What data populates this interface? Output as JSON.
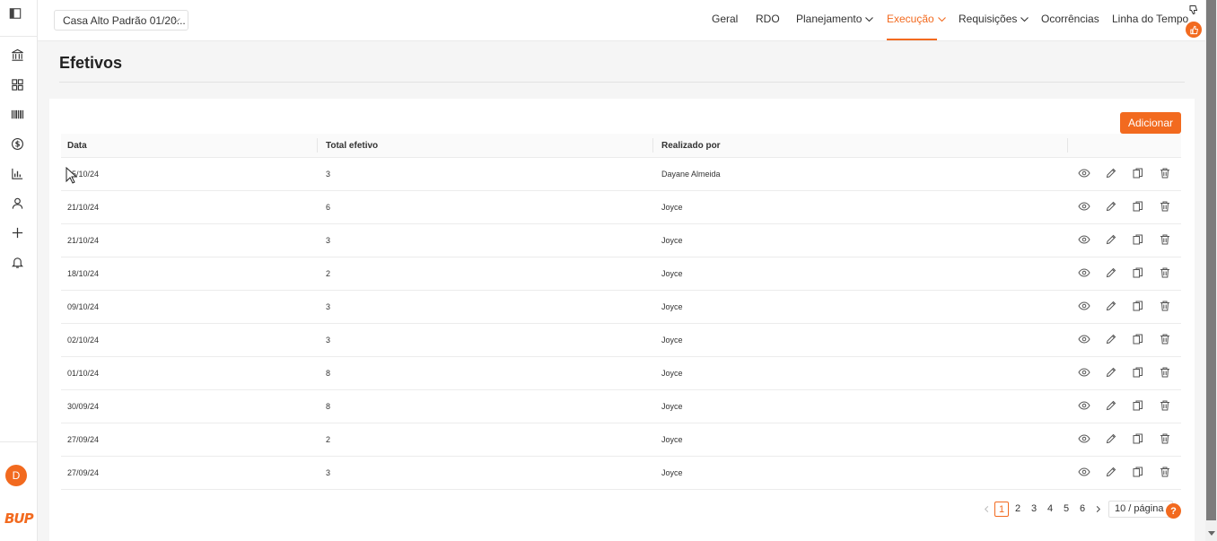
{
  "sidebar": {
    "icons": [
      "sidebar-toggle-icon",
      "bank-icon",
      "grid-icon",
      "barcode-icon",
      "dollar-icon",
      "bar-chart-icon",
      "user-icon",
      "plus-icon",
      "bell-icon"
    ],
    "avatar_initial": "D",
    "logo_text": "BUP"
  },
  "header": {
    "project": "Casa Alto Padrão 01/20...",
    "nav": [
      {
        "label": "Geral"
      },
      {
        "label": "RDO"
      },
      {
        "label": "Planejamento"
      },
      {
        "label": "Execução"
      },
      {
        "label": "Requisições"
      },
      {
        "label": "Ocorrências"
      },
      {
        "label": "Linha do Tempo"
      }
    ],
    "active_nav": "Execução"
  },
  "page": {
    "title": "Efetivos",
    "add_label": "Adicionar"
  },
  "table": {
    "columns": [
      "Data",
      "Total efetivo",
      "Realizado por"
    ],
    "rows": [
      {
        "date": "25/10/24",
        "total": "3",
        "by": "Dayane Almeida"
      },
      {
        "date": "21/10/24",
        "total": "6",
        "by": "Joyce"
      },
      {
        "date": "21/10/24",
        "total": "3",
        "by": "Joyce"
      },
      {
        "date": "18/10/24",
        "total": "2",
        "by": "Joyce"
      },
      {
        "date": "09/10/24",
        "total": "3",
        "by": "Joyce"
      },
      {
        "date": "02/10/24",
        "total": "3",
        "by": "Joyce"
      },
      {
        "date": "01/10/24",
        "total": "8",
        "by": "Joyce"
      },
      {
        "date": "30/09/24",
        "total": "8",
        "by": "Joyce"
      },
      {
        "date": "27/09/24",
        "total": "2",
        "by": "Joyce"
      },
      {
        "date": "27/09/24",
        "total": "3",
        "by": "Joyce"
      }
    ],
    "row_actions": [
      "eye-icon",
      "edit-icon",
      "copy-icon",
      "trash-icon"
    ]
  },
  "pagination": {
    "pages": [
      "1",
      "2",
      "3",
      "4",
      "5",
      "6"
    ],
    "current": "1",
    "page_size": "10 / página",
    "help": "?"
  },
  "colors": {
    "accent": "#f26a1f"
  }
}
